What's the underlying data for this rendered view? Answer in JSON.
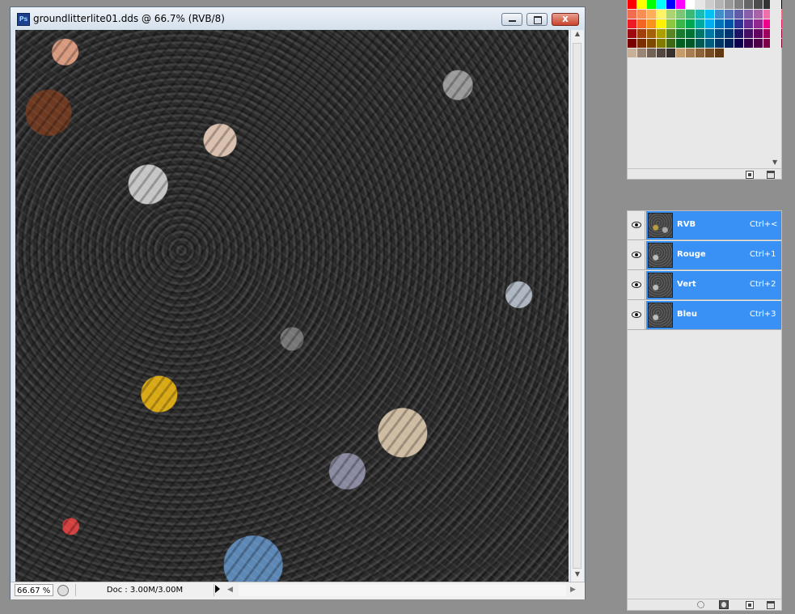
{
  "document": {
    "title": "groundlitterlite01.dds @ 66.7% (RVB/8)",
    "app_icon_label": "Ps",
    "close_label": "x",
    "zoom": "66.67 %",
    "doc_info": "Doc : 3.00M/3.00M"
  },
  "swatches": {
    "colors": [
      "#ff0000",
      "#ffff00",
      "#00ff00",
      "#00ffff",
      "#0000ff",
      "#ff00ff",
      "#ffffff",
      "#e6e6e6",
      "#cccccc",
      "#b3b3b3",
      "#999999",
      "#808080",
      "#666666",
      "#4d4d4d",
      "#333333",
      "#000000",
      "#f26c4f",
      "#f68e55",
      "#fbaf5c",
      "#fff467",
      "#acd372",
      "#7cc576",
      "#3bb878",
      "#1abbb4",
      "#00bff3",
      "#438ccb",
      "#5574b9",
      "#605ca8",
      "#855fa8",
      "#a763a8",
      "#f06ea9",
      "#f26d7d",
      "#ed1c24",
      "#f26522",
      "#f7941d",
      "#fff200",
      "#8dc63f",
      "#39b54a",
      "#00a651",
      "#00a99d",
      "#00aeef",
      "#0072bc",
      "#0054a6",
      "#2e3192",
      "#662d91",
      "#92278f",
      "#ec008c",
      "#ed145b",
      "#9e0b0f",
      "#a0410d",
      "#a3620a",
      "#aba000",
      "#598527",
      "#1a7b30",
      "#007236",
      "#00746b",
      "#0076a3",
      "#004b80",
      "#003471",
      "#1b1464",
      "#440e62",
      "#630460",
      "#9e005d",
      "#9e0039",
      "#790000",
      "#7b2e00",
      "#7d4900",
      "#827b00",
      "#406618",
      "#005e20",
      "#005826",
      "#005952",
      "#005b7f",
      "#003663",
      "#002157",
      "#0d004c",
      "#32004b",
      "#4b0049",
      "#7b0046",
      "#7a0026",
      "#c7b299",
      "#998675",
      "#736357",
      "#534741",
      "#37302d",
      "#c69c6d",
      "#a67c52",
      "#8c6239",
      "#754c24",
      "#603913"
    ]
  },
  "channels": [
    {
      "name": "RVB",
      "shortcut": "Ctrl+<"
    },
    {
      "name": "Rouge",
      "shortcut": "Ctrl+1"
    },
    {
      "name": "Vert",
      "shortcut": "Ctrl+2"
    },
    {
      "name": "Bleu",
      "shortcut": "Ctrl+3"
    }
  ]
}
